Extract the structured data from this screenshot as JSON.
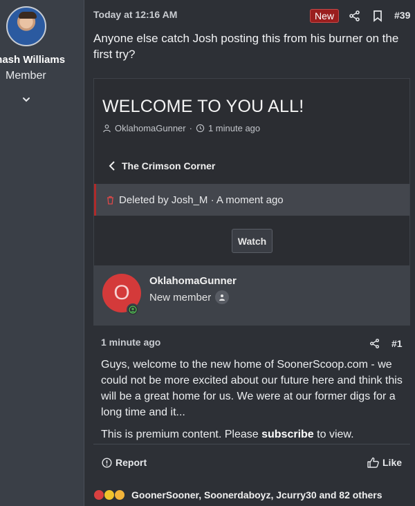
{
  "author": {
    "name": "mash Williams",
    "title": "Member"
  },
  "post": {
    "time": "Today at 12:16 AM",
    "new_badge": "New",
    "number": "#39",
    "text": "Anyone else catch Josh posting this from his burner on the first try?"
  },
  "embed": {
    "title": "WELCOME TO YOU ALL!",
    "meta_author": "OklahomaGunner",
    "meta_sep": "·",
    "meta_time": "1 minute ago",
    "back_label": "The Crimson Corner",
    "deleted_text": "Deleted by Josh_M · A moment ago",
    "watch_label": "Watch",
    "member": {
      "avatar_letter": "O",
      "name": "OklahomaGunner",
      "role": "New member"
    }
  },
  "reply": {
    "time": "1 minute ago",
    "number": "#1",
    "text": "Guys, welcome to the new home of SoonerScoop.com - we could not be more excited about our future here and think this will be a great home for us. We were at our former digs for a long time and it...",
    "premium_prefix": "This is premium content. Please",
    "premium_link": "subscribe",
    "premium_suffix": "to view."
  },
  "actions": {
    "report_label": "Report",
    "like_label": "Like"
  },
  "reactions": {
    "users_text": "GoonerSooner, Soonerdaboyz, Jcurry30 and 82 others"
  },
  "colors": {
    "accent_red": "#9a1e1e",
    "avatar_red": "#d43a3a",
    "online_green": "#4caf50"
  },
  "icons": [
    "share-icon",
    "bookmark-icon",
    "user-icon",
    "clock-icon",
    "chevron-left-icon",
    "trash-icon",
    "online-icon",
    "user-badge-icon",
    "report-icon",
    "thumbs-up-icon",
    "chevron-down-icon"
  ]
}
